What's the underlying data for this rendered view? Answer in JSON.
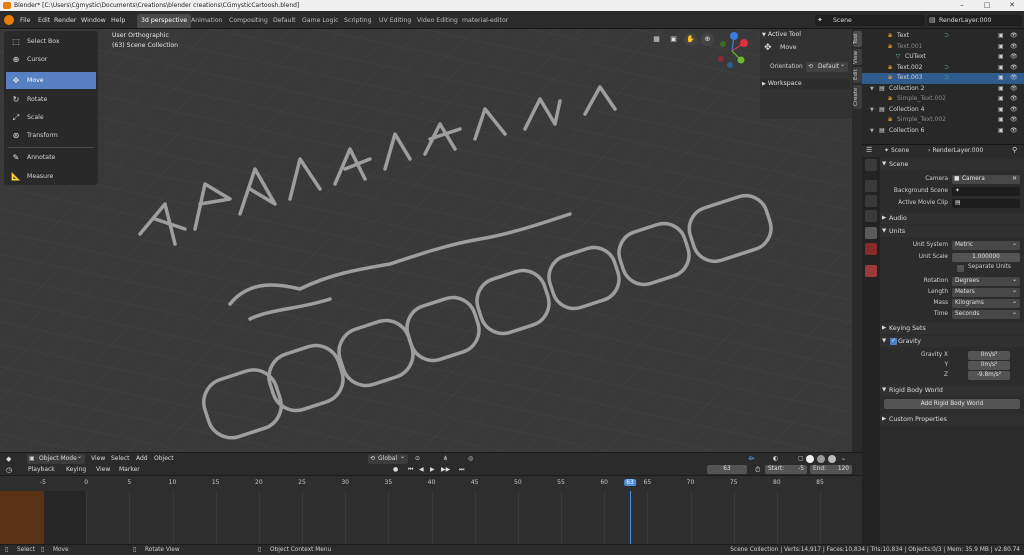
{
  "window": {
    "title": "Blender* [C:\\Users\\Cgmystic\\Documents\\Creations\\blender creations\\CGmysticCartoosh.blend]"
  },
  "menu": [
    "File",
    "Edit",
    "Render",
    "Window",
    "Help"
  ],
  "workspaces": [
    "3d perspective",
    "Animation",
    "Compositing",
    "Default",
    "Game Logic",
    "Scripting",
    "UV Editing",
    "Video Editing",
    "material-editor"
  ],
  "scene_selector": "Scene",
  "layer_selector": "RenderLayer.000",
  "tools": [
    "Select Box",
    "Cursor",
    "Move",
    "Rotate",
    "Scale",
    "Transform",
    "Annotate",
    "Measure"
  ],
  "viewport": {
    "view_name": "User Orthographic",
    "collection": "(63) Scene Collection"
  },
  "side_panel": {
    "active_tool_header": "Active Tool",
    "tool_name": "Move",
    "orientation_label": "Orientation",
    "orientation_value": "Default",
    "workspace_header": "Workspace",
    "tabs": [
      "Tool",
      "View",
      "Edit",
      "Create"
    ]
  },
  "viewport_header": {
    "mode": "Object Mode",
    "menus": [
      "View",
      "Select",
      "Add",
      "Object"
    ],
    "transform_orientation": "Global"
  },
  "timeline": {
    "header_menus": [
      "Playback",
      "Keying",
      "View",
      "Marker"
    ],
    "current_frame": "63",
    "start_label": "Start:",
    "start_value": "-5",
    "end_label": "End:",
    "end_value": "120",
    "ruler": [
      "-5",
      "0",
      "5",
      "10",
      "15",
      "20",
      "25",
      "30",
      "35",
      "40",
      "45",
      "50",
      "55",
      "60",
      "63",
      "65",
      "70",
      "75",
      "80",
      "85"
    ]
  },
  "outliner": {
    "rows": [
      {
        "label": "Text",
        "indent": 2,
        "icon": "text",
        "selected": false,
        "dim": false
      },
      {
        "label": "Text.001",
        "indent": 2,
        "icon": "text",
        "selected": false,
        "dim": true
      },
      {
        "label": "CUText",
        "indent": 3,
        "icon": "curve",
        "selected": false,
        "dim": false
      },
      {
        "label": "Text.002",
        "indent": 2,
        "icon": "text",
        "selected": false,
        "dim": false
      },
      {
        "label": "Text.003",
        "indent": 2,
        "icon": "text",
        "selected": true,
        "dim": false
      },
      {
        "label": "Collection 2",
        "indent": 1,
        "icon": "collection",
        "selected": false,
        "dim": false
      },
      {
        "label": "Simple_Text.002",
        "indent": 2,
        "icon": "text",
        "selected": false,
        "dim": true
      },
      {
        "label": "Collection 4",
        "indent": 1,
        "icon": "collection",
        "selected": false,
        "dim": false
      },
      {
        "label": "Simple_Text.002",
        "indent": 2,
        "icon": "text",
        "selected": false,
        "dim": true
      },
      {
        "label": "Collection 6",
        "indent": 1,
        "icon": "collection",
        "selected": false,
        "dim": false
      }
    ]
  },
  "properties": {
    "context_scene": "Scene",
    "context_layer": "RenderLayer.000",
    "scene_section": "Scene",
    "camera_label": "Camera",
    "camera_value": "Camera",
    "background_label": "Background Scene",
    "movieclip_label": "Active Movie Clip",
    "audio_section": "Audio",
    "units_section": "Units",
    "unit_system_label": "Unit System",
    "unit_system_value": "Metric",
    "unit_scale_label": "Unit Scale",
    "unit_scale_value": "1.000000",
    "separate_units": "Separate Units",
    "rotation_label": "Rotation",
    "rotation_value": "Degrees",
    "length_label": "Length",
    "length_value": "Meters",
    "mass_label": "Mass",
    "mass_value": "Kilograms",
    "time_label": "Time",
    "time_value": "Seconds",
    "keying_section": "Keying Sets",
    "gravity_section": "Gravity",
    "gravity_x_label": "Gravity X",
    "gravity_x": "0m/s²",
    "gravity_y_label": "Y",
    "gravity_y": "0m/s²",
    "gravity_z_label": "Z",
    "gravity_z": "-9.8m/s²",
    "rigid_section": "Rigid Body World",
    "add_rigid_button": "Add Rigid Body World",
    "custom_section": "Custom Properties"
  },
  "statusbar": {
    "select": "Select",
    "move": "Move",
    "rotate_view": "Rotate View",
    "context_menu": "Object Context Menu",
    "stats": "Scene Collection | Verts:14,917 | Faces:10,834 | Tris:10,834 | Objects:0/3 | Mem: 35.9 MB | v2.80.74"
  },
  "colors": {
    "accent": "#5680c2",
    "brand": "#e87d0d",
    "playhead": "#4f8fd9",
    "x_axis": "#e0303f",
    "y_axis": "#6cb82f",
    "z_axis": "#3b7be0"
  }
}
